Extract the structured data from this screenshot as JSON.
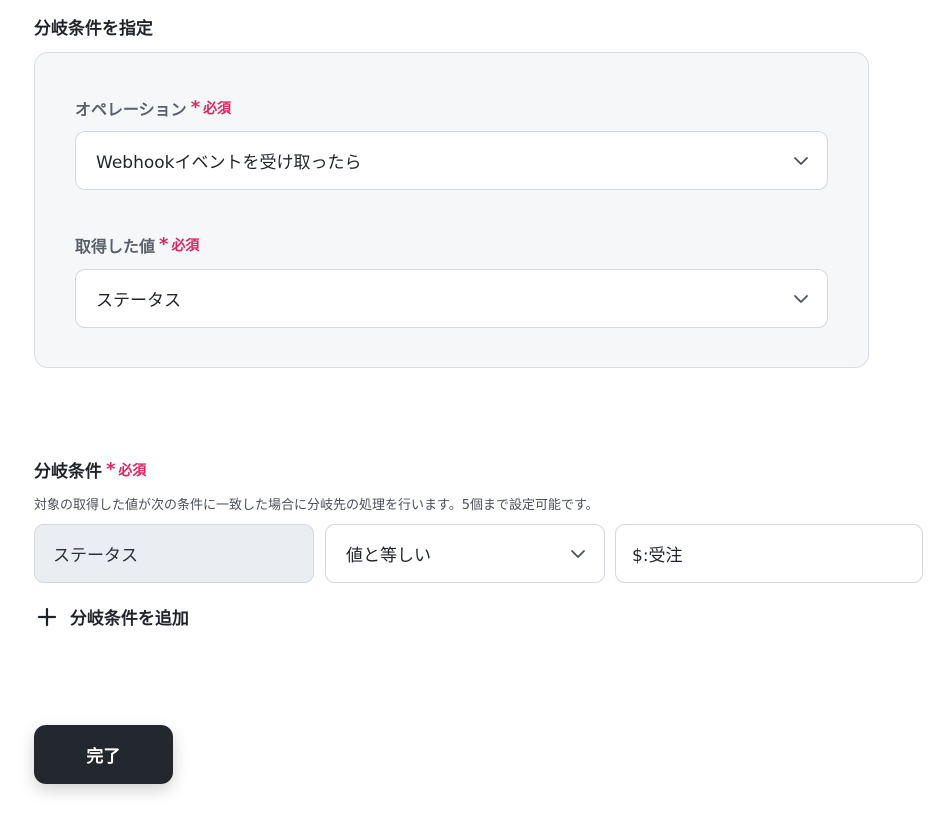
{
  "section": {
    "title": "分岐条件を指定"
  },
  "panel": {
    "operation": {
      "label": "オペレーション",
      "required_mark": "*",
      "required_text": "必須",
      "value": "Webhookイベントを受け取ったら"
    },
    "acquired_value": {
      "label": "取得した値",
      "required_mark": "*",
      "required_text": "必須",
      "value": "ステータス"
    }
  },
  "condition": {
    "title": "分岐条件",
    "required_mark": "*",
    "required_text": "必須",
    "helper": "対象の取得した値が次の条件に一致した場合に分岐先の処理を行います。5個まで設定可能です。",
    "row": {
      "target": "ステータス",
      "operator": "値と等しい",
      "value": "$:受注"
    },
    "add_label": "分岐条件を追加"
  },
  "footer": {
    "done_label": "完了"
  },
  "colors": {
    "required": "#e0245e",
    "primary_button": "#23272e",
    "panel_bg": "#f6f7f9"
  },
  "icons": {
    "dropdown": "chevron-down-icon",
    "add": "plus-icon",
    "required": "asterisk-icon"
  }
}
